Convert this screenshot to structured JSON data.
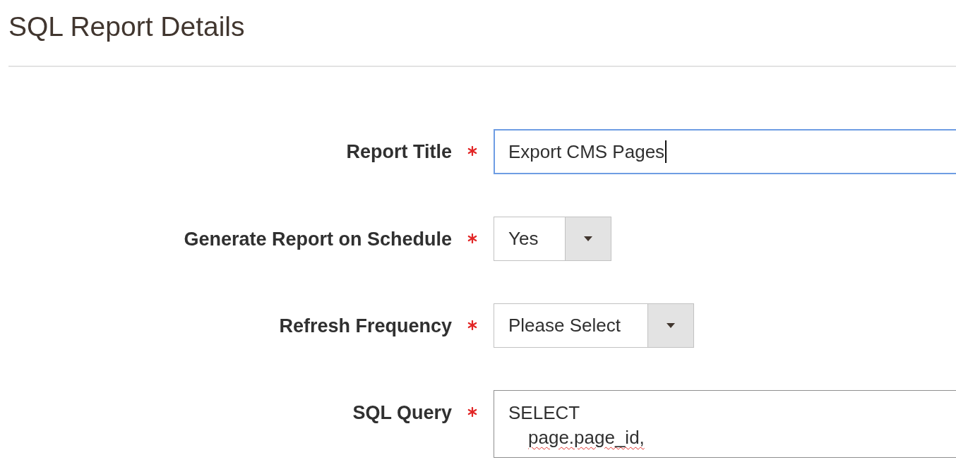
{
  "page": {
    "title": "SQL Report Details"
  },
  "fields": [
    {
      "kind": "text",
      "label": "Report Title",
      "required": true,
      "value": "Export CMS Pages",
      "focused": true
    },
    {
      "kind": "select",
      "label": "Generate Report on Schedule",
      "required": true,
      "value": "Yes"
    },
    {
      "kind": "select",
      "label": "Refresh Frequency",
      "required": true,
      "value": "Please Select"
    },
    {
      "kind": "code",
      "label": "SQL Query",
      "required": true,
      "lines": [
        {
          "text": "SELECT",
          "misspelled": false,
          "children": [
            {
              "text": "page.page_id,",
              "misspelled": true
            }
          ]
        }
      ]
    }
  ]
}
